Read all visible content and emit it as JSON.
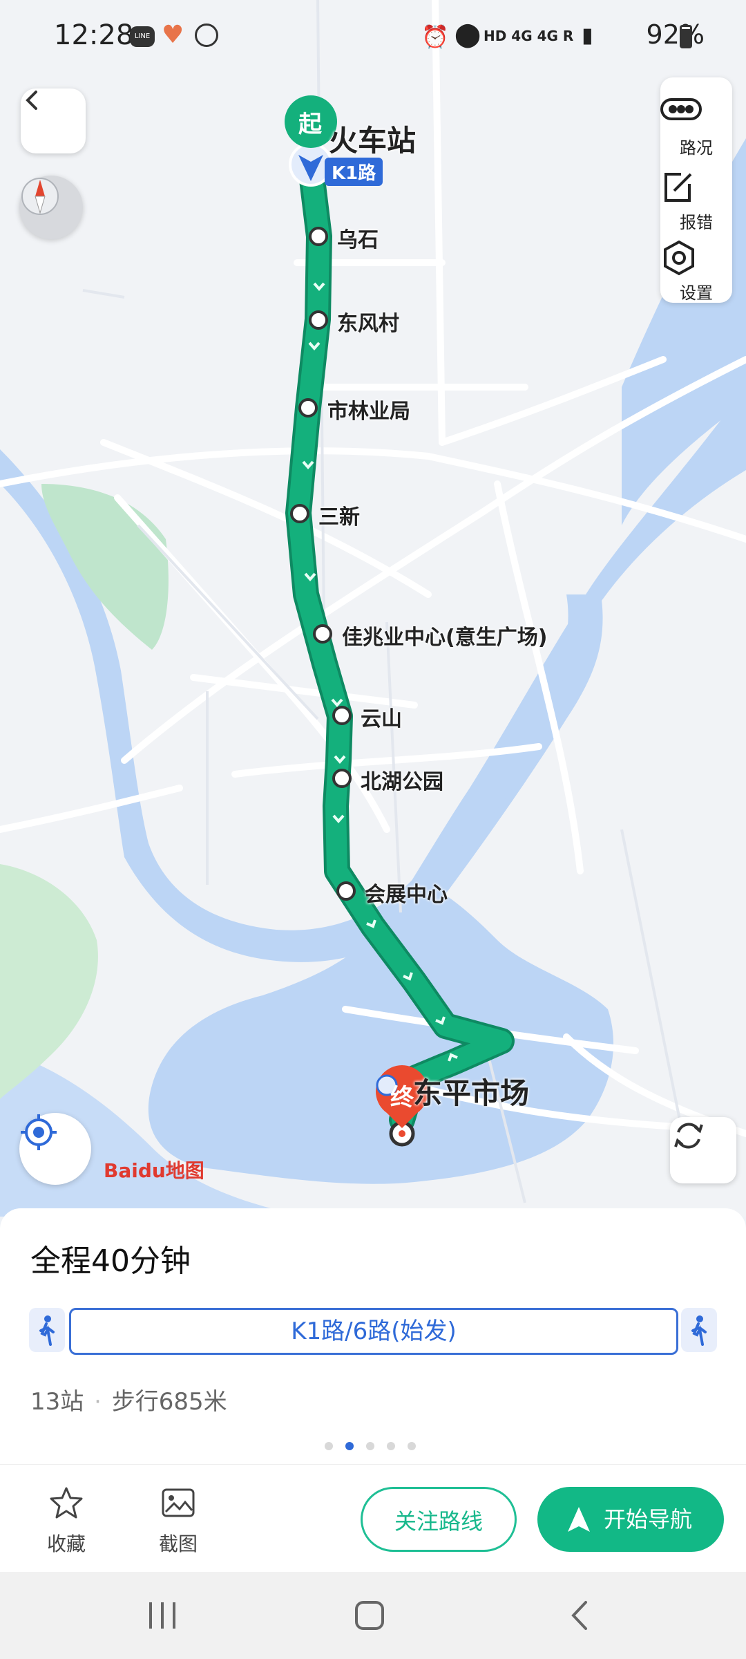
{
  "status_bar": {
    "time": "12:28",
    "battery": "92%",
    "network": "HD 4G 4G R",
    "icons": [
      "line-icon",
      "heart-icon",
      "whatsapp-icon",
      "alarm-icon",
      "location-icon",
      "signal-icon",
      "battery-icon"
    ]
  },
  "map": {
    "start_marker": "起",
    "end_marker": "终",
    "start_station": "火车站",
    "end_station": "东平市场",
    "line_badge": "K1路",
    "logo": "Baidu地图",
    "route_color": "#14b07c",
    "water_color": "#bcd5f5",
    "stops": [
      "乌石",
      "东风村",
      "市林业局",
      "三新",
      "佳兆业中心(意生广场)",
      "云山",
      "北湖公园",
      "会展中心"
    ]
  },
  "right_panel": {
    "traffic_label": "路况",
    "report_label": "报错",
    "settings_label": "设置"
  },
  "card": {
    "total_time": "全程40分钟",
    "route_name": "K1路/6路(始发)",
    "stops_count": "13站",
    "walk": "步行685米",
    "separator": "·",
    "page_dots": 5,
    "active_dot": 2
  },
  "bottom_bar": {
    "favorite_label": "收藏",
    "screenshot_label": "截图",
    "follow_label": "关注路线",
    "navigate_label": "开始导航"
  },
  "colors": {
    "accent": "#12b886",
    "route_blue": "#2f6ad8",
    "end_red": "#ea4a2f"
  }
}
